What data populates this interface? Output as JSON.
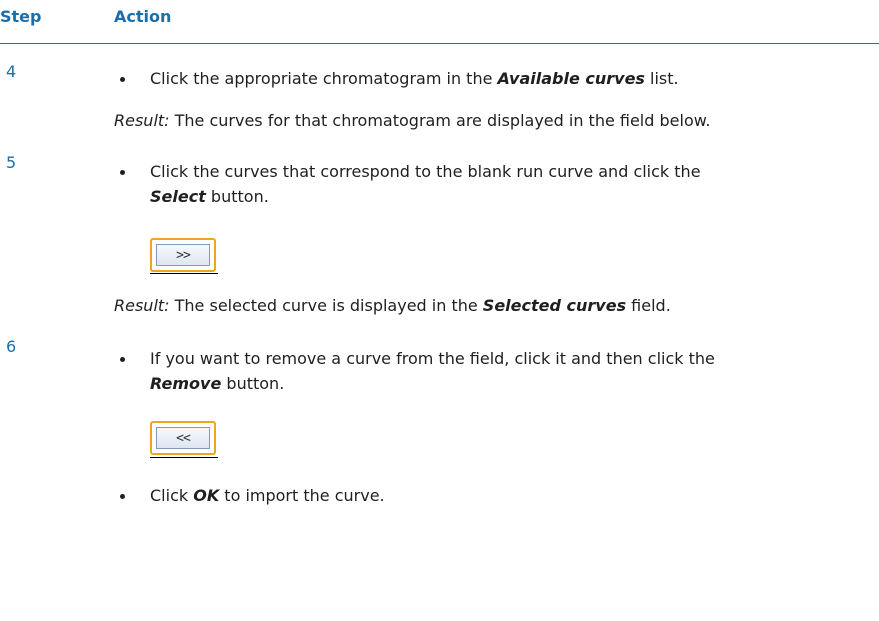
{
  "header": {
    "step_label": "Step",
    "action_label": "Action"
  },
  "steps": [
    {
      "number": "4",
      "line1_pre": "Click the appropriate chromatogram in the ",
      "line1_em": "Available curves",
      "line1_post": " list.",
      "result_label": "Result:",
      "result_text": " The curves for that chromatogram are displayed in the field below."
    },
    {
      "number": "5",
      "line1": "Click the curves that correspond to the blank run curve and click the",
      "line2_em": "Select",
      "line2_post": " button.",
      "button_glyph": ">>",
      "result_label": "Result:",
      "result_pre": " The selected curve is displayed in the ",
      "result_em": "Selected curves",
      "result_post": " field."
    },
    {
      "number": "6",
      "line1": "If you want to remove a curve from the field, click it and then click the",
      "line2_em": "Remove",
      "line2_post": " button.",
      "button_glyph": "<<",
      "bullet2_pre": "Click ",
      "bullet2_em": "OK",
      "bullet2_post": " to import the curve."
    }
  ]
}
